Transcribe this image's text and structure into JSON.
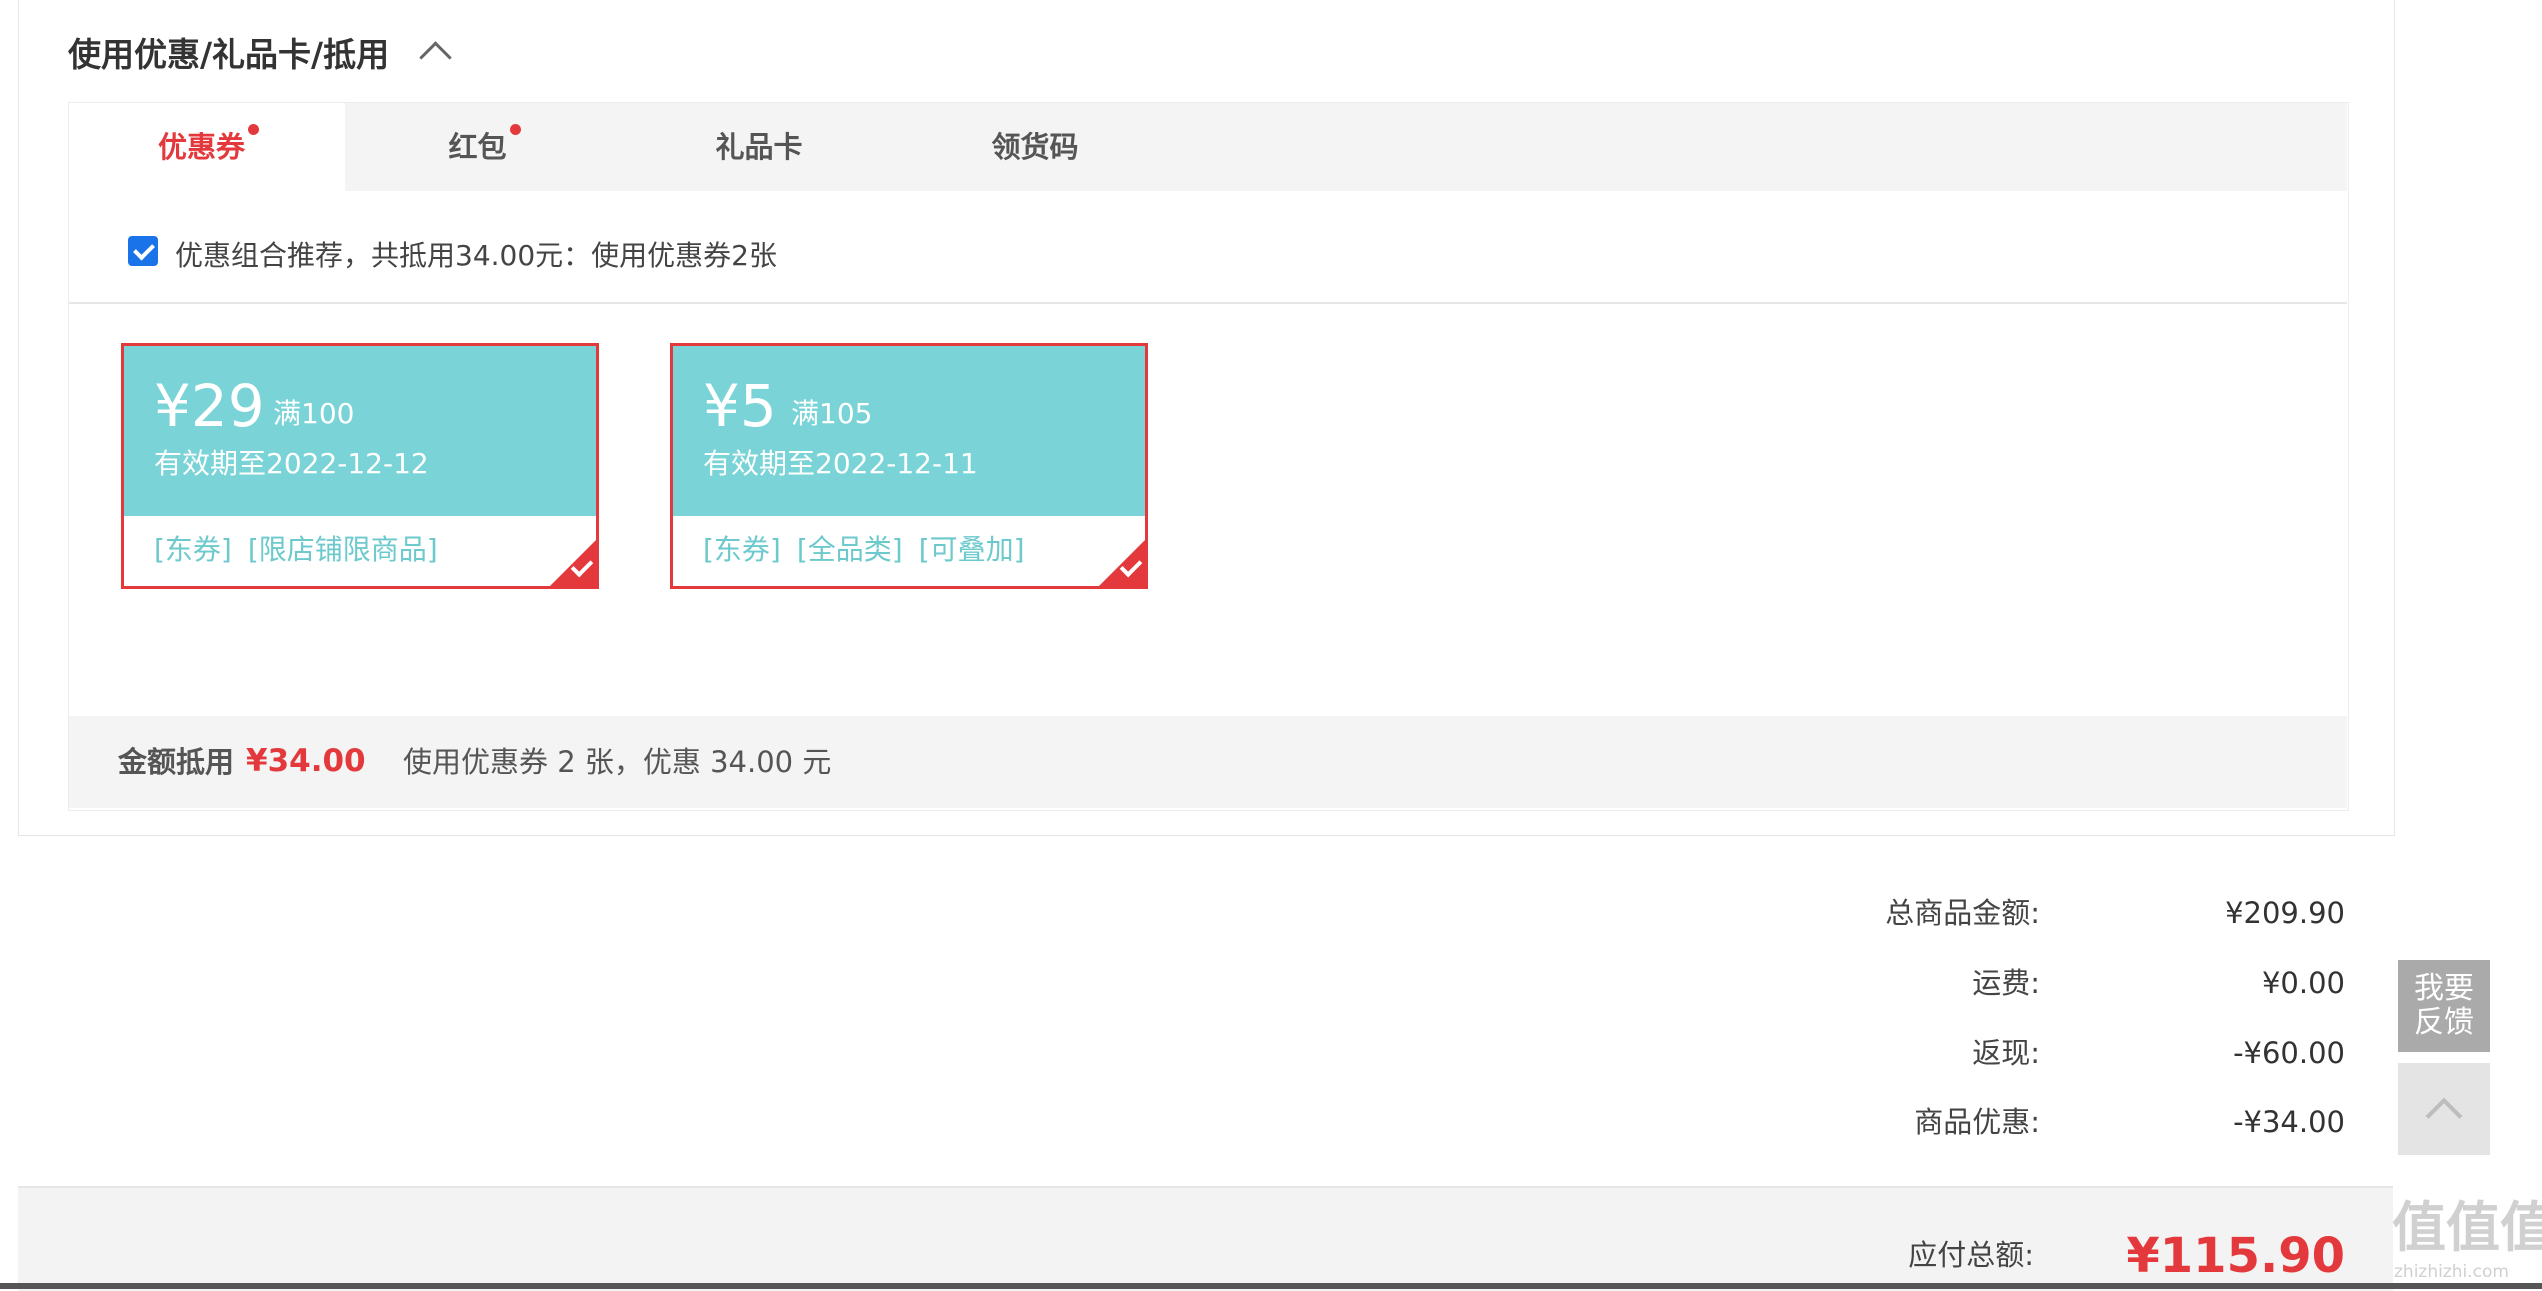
{
  "section": {
    "title": "使用优惠/礼品卡/抵用"
  },
  "tabs": [
    {
      "label": "优惠券",
      "active": true,
      "dot": true
    },
    {
      "label": "红包",
      "active": false,
      "dot": true
    },
    {
      "label": "礼品卡",
      "active": false,
      "dot": false
    },
    {
      "label": "领货码",
      "active": false,
      "dot": false
    }
  ],
  "combo": {
    "checked": true,
    "text": "优惠组合推荐，共抵用34.00元：使用优惠券2张"
  },
  "coupons": [
    {
      "amount": "¥29",
      "condition": "满100",
      "validity": "有效期至2022-12-12",
      "tags": [
        "[东券]",
        "[限店铺限商品]"
      ],
      "selected": true
    },
    {
      "amount": "¥5",
      "condition": "满105",
      "validity": "有效期至2022-12-11",
      "tags": [
        "[东券]",
        "[全品类]",
        "[可叠加]"
      ],
      "selected": true
    }
  ],
  "summary": {
    "label": "金额抵用",
    "amount": "¥34.00",
    "desc": "使用优惠券 2 张，优惠 34.00 元"
  },
  "totals": [
    {
      "label": "总商品金额:",
      "value": "¥209.90"
    },
    {
      "label": "运费:",
      "value": "¥0.00"
    },
    {
      "label": "返现:",
      "value": "-¥60.00"
    },
    {
      "label": "商品优惠:",
      "value": "-¥34.00"
    }
  ],
  "payable": {
    "label": "应付总额:",
    "value": "¥115.90"
  },
  "side": {
    "feedback_line1": "我要",
    "feedback_line2": "反馈"
  },
  "watermark": {
    "main": "值值值",
    "sub": "zhizhizhi.com"
  },
  "colors": {
    "accent": "#e4393c",
    "coupon": "#7ad3d6",
    "checkbox": "#1a73e8"
  }
}
